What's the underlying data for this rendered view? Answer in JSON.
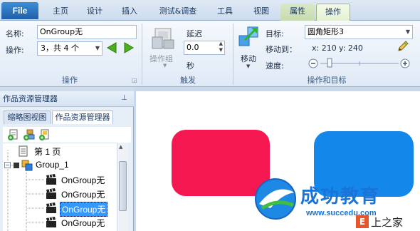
{
  "tabs": {
    "file": "File",
    "home": "主页",
    "design": "设计",
    "insert": "插入",
    "test": "测试&调查",
    "tools": "工具",
    "view": "视图",
    "properties": "属性",
    "actions": "操作"
  },
  "ribbon": {
    "name_label": "名称:",
    "name_value": "OnGroup无",
    "action_label": "操作:",
    "action_value": "3，共 4 个",
    "group_action_label": "操作",
    "action_group_btn": "操作组",
    "delay_label": "延迟",
    "delay_value": "0.0",
    "seconds_label": "秒",
    "trigger_group_label": "触发",
    "move_btn": "移动",
    "target_label": "目标:",
    "target_value": "圆角矩形3",
    "move_to_label": "移动到：",
    "x_label": "x: 210",
    "y_label": "y: 240",
    "speed_label": "速度:",
    "action_target_group_label": "操作和目标"
  },
  "panel": {
    "title": "作品资源管理器",
    "pin": "ꟷ",
    "tab_thumbnail": "缩略图视图",
    "tab_explorer": "作品资源管理器",
    "tree": [
      {
        "label": "第 1 页",
        "indent": 0,
        "selected": false,
        "icon": "page-icon"
      },
      {
        "label": "Group_1",
        "indent": 1,
        "selected": false,
        "icon": "group-icon"
      },
      {
        "label": "OnGroup无",
        "indent": 2,
        "selected": false,
        "icon": "action-icon"
      },
      {
        "label": "OnGroup无",
        "indent": 2,
        "selected": false,
        "icon": "action-icon"
      },
      {
        "label": "OnGroup无",
        "indent": 2,
        "selected": true,
        "icon": "action-icon"
      },
      {
        "label": "OnGroup无",
        "indent": 2,
        "selected": false,
        "icon": "action-icon"
      }
    ]
  },
  "watermark": {
    "brand_cn": "成功教育",
    "url": "www.succedu.com",
    "partner": "上之家"
  },
  "colors": {
    "shape_red": "#f5174f",
    "shape_blue": "#1487ea",
    "accent_green": "#4caf1e",
    "file_blue": "#2a6fc0"
  }
}
